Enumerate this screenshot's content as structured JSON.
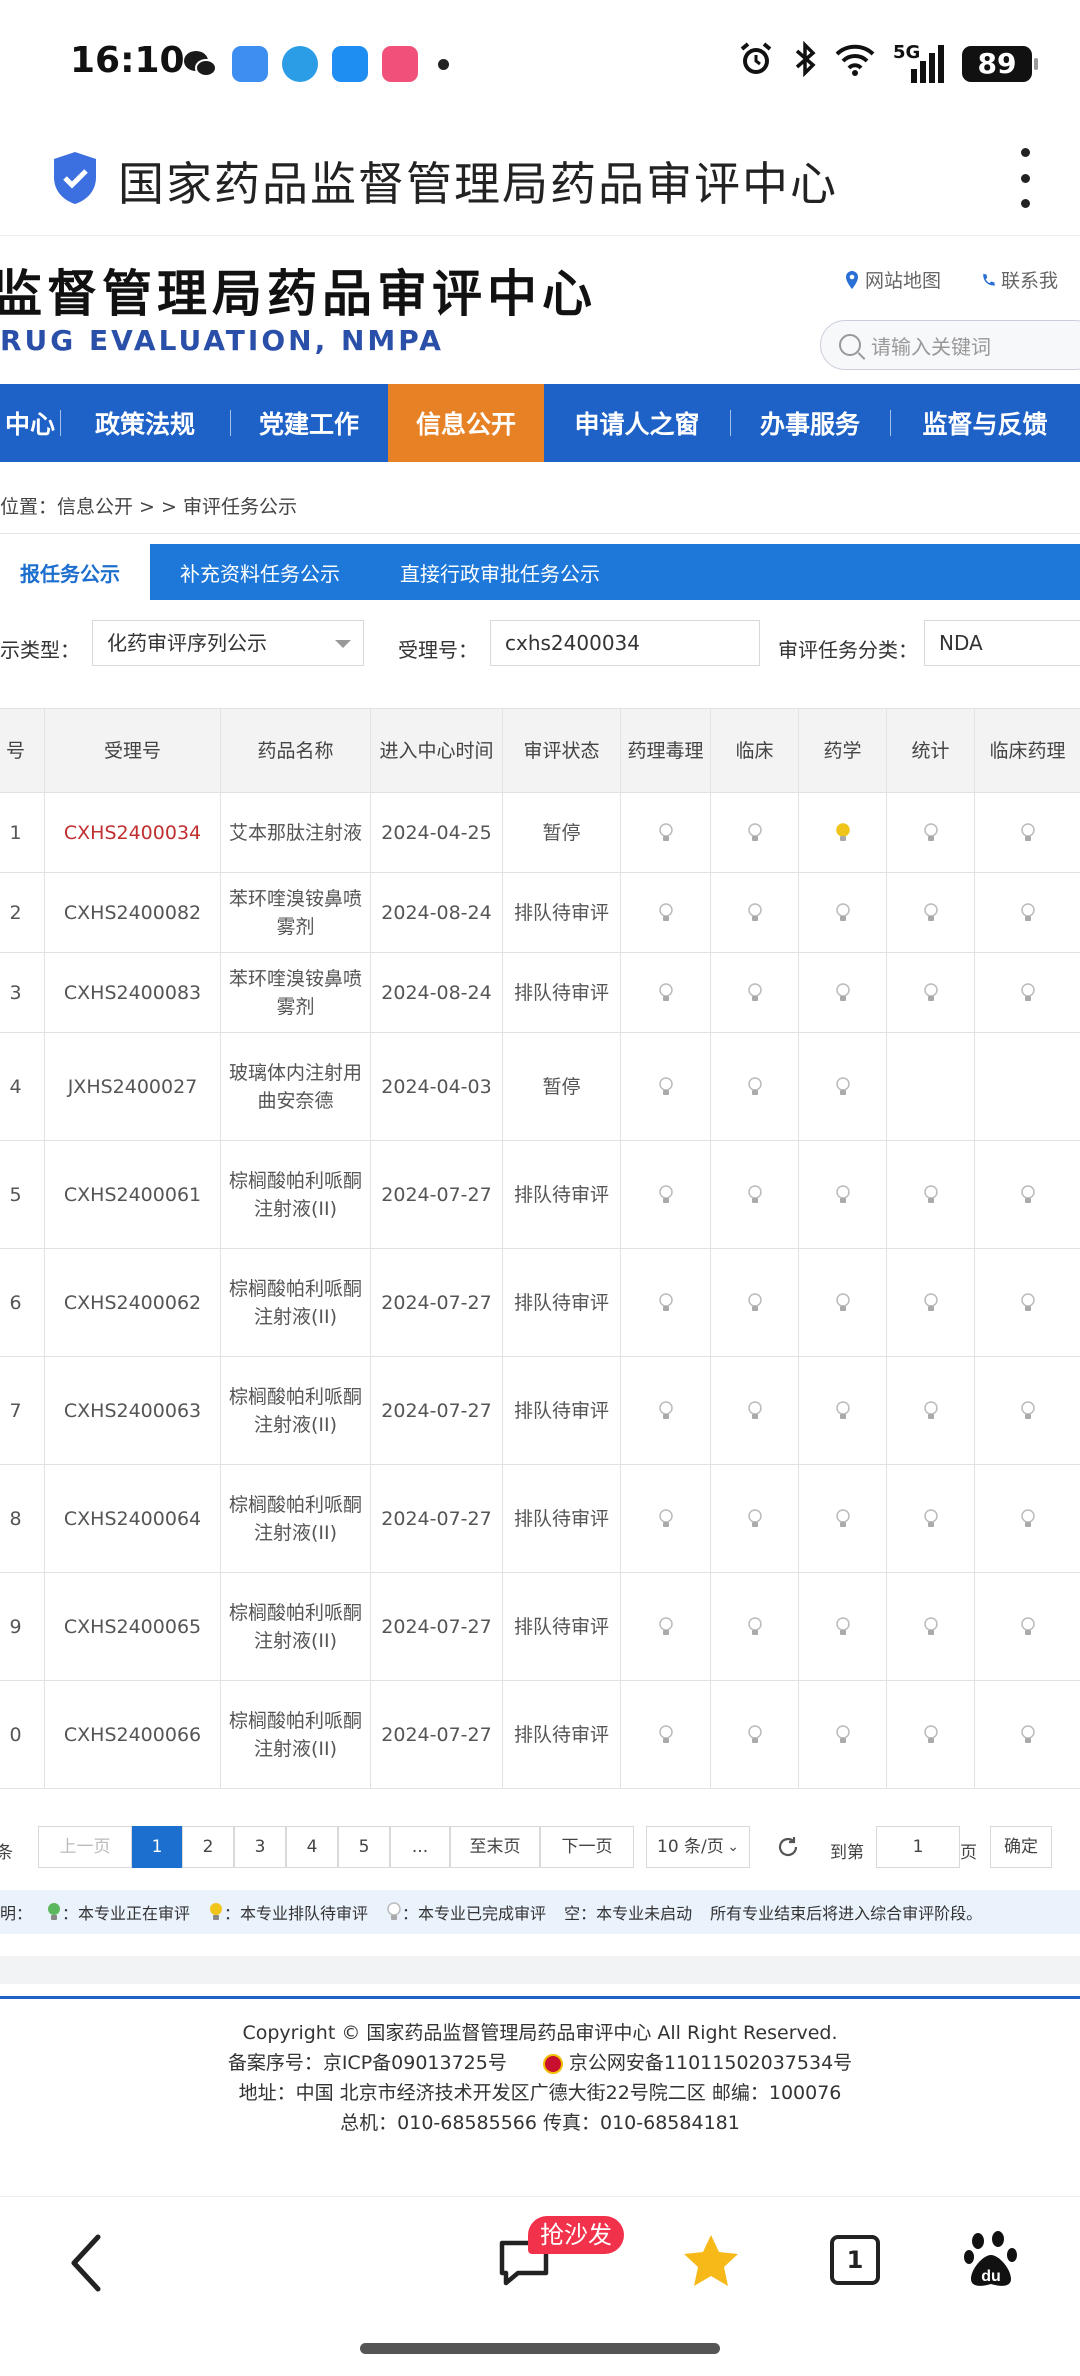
{
  "status_bar": {
    "time": "16:10",
    "network": "5G",
    "battery": "89",
    "app_icon_colors": [
      "#1a1a1a",
      "#3d8ef0",
      "#2a9de6",
      "#1f8ef2",
      "#f0507a"
    ]
  },
  "browser": {
    "title": "国家药品监督管理局药品审评中心"
  },
  "site": {
    "logo_cn": "监督管理局药品审评中心",
    "logo_en": "RUG EVALUATION, NMPA",
    "links": [
      "网站地图",
      "联系我"
    ],
    "search_placeholder": "请输入关键词"
  },
  "nav": {
    "items": [
      "中心",
      "政策法规",
      "党建工作",
      "信息公开",
      "申请人之窗",
      "办事服务",
      "监督与反馈"
    ],
    "active_index": 3,
    "active_color": "#e78125",
    "bar_color": "#1e62c7"
  },
  "breadcrumb": "位置：信息公开 > > 审评任务公示",
  "subtabs": {
    "items": [
      "报任务公示",
      "补充资料任务公示",
      "直接行政审批任务公示"
    ],
    "active_index": 0
  },
  "filters": {
    "type_label": "示类型：",
    "type_value": "化药审评序列公示",
    "accept_no_label": "受理号：",
    "accept_no_value": "cxhs2400034",
    "category_label": "审评任务分类：",
    "category_value": "NDA"
  },
  "table": {
    "headers": [
      "号",
      "受理号",
      "药品名称",
      "进入中心时间",
      "审评状态",
      "药理毒理",
      "临床",
      "药学",
      "统计",
      "临床药理"
    ],
    "rows": [
      {
        "seq": "1",
        "id": "CXHS2400034",
        "highlight": true,
        "name": "艾本那肽注射液",
        "date": "2024-04-25",
        "status": "暂停",
        "bulbs": [
          "done",
          "done",
          "queue",
          "done",
          "done"
        ]
      },
      {
        "seq": "2",
        "id": "CXHS2400082",
        "highlight": false,
        "name": "苯环喹溴铵鼻喷雾剂",
        "date": "2024-08-24",
        "status": "排队待审评",
        "bulbs": [
          "done",
          "done",
          "done",
          "done",
          "done"
        ]
      },
      {
        "seq": "3",
        "id": "CXHS2400083",
        "highlight": false,
        "name": "苯环喹溴铵鼻喷雾剂",
        "date": "2024-08-24",
        "status": "排队待审评",
        "bulbs": [
          "done",
          "done",
          "done",
          "done",
          "done"
        ]
      },
      {
        "seq": "4",
        "id": "JXHS2400027",
        "highlight": false,
        "name": "玻璃体内注射用曲安奈德",
        "date": "2024-04-03",
        "status": "暂停",
        "bulbs": [
          "done",
          "done",
          "done",
          "none",
          "none"
        ]
      },
      {
        "seq": "5",
        "id": "CXHS2400061",
        "highlight": false,
        "name": "棕榈酸帕利哌酮注射液(II)",
        "date": "2024-07-27",
        "status": "排队待审评",
        "bulbs": [
          "done",
          "done",
          "done",
          "done",
          "done"
        ]
      },
      {
        "seq": "6",
        "id": "CXHS2400062",
        "highlight": false,
        "name": "棕榈酸帕利哌酮注射液(II)",
        "date": "2024-07-27",
        "status": "排队待审评",
        "bulbs": [
          "done",
          "done",
          "done",
          "done",
          "done"
        ]
      },
      {
        "seq": "7",
        "id": "CXHS2400063",
        "highlight": false,
        "name": "棕榈酸帕利哌酮注射液(II)",
        "date": "2024-07-27",
        "status": "排队待审评",
        "bulbs": [
          "done",
          "done",
          "done",
          "done",
          "done"
        ]
      },
      {
        "seq": "8",
        "id": "CXHS2400064",
        "highlight": false,
        "name": "棕榈酸帕利哌酮注射液(II)",
        "date": "2024-07-27",
        "status": "排队待审评",
        "bulbs": [
          "done",
          "done",
          "done",
          "done",
          "done"
        ]
      },
      {
        "seq": "9",
        "id": "CXHS2400065",
        "highlight": false,
        "name": "棕榈酸帕利哌酮注射液(II)",
        "date": "2024-07-27",
        "status": "排队待审评",
        "bulbs": [
          "done",
          "done",
          "done",
          "done",
          "done"
        ]
      },
      {
        "seq": "0",
        "id": "CXHS2400066",
        "highlight": false,
        "name": "棕榈酸帕利哌酮注射液(II)",
        "date": "2024-07-27",
        "status": "排队待审评",
        "bulbs": [
          "done",
          "done",
          "done",
          "done",
          "done"
        ]
      }
    ]
  },
  "pagination": {
    "total_prefix": "条",
    "prev": "上一页",
    "pages": [
      "1",
      "2",
      "3",
      "4",
      "5",
      "..."
    ],
    "current": "1",
    "last": "至末页",
    "next": "下一页",
    "page_size": "10 条/页",
    "goto_label": "到第",
    "goto_value": "1",
    "page_unit": "页",
    "confirm": "确定"
  },
  "legend": {
    "prefix": "明：",
    "in_review": "：本专业正在审评",
    "queued": "：本专业排队待审评",
    "done": "：本专业已完成审评",
    "empty": "空：本专业未启动",
    "note": "所有专业结束后将进入综合审评阶段。",
    "colors": {
      "in_review": "#5cb85c",
      "queued": "#f0c419",
      "done": "#d0d0d0"
    }
  },
  "footer": {
    "copyright": "Copyright © 国家药品监督管理局药品审评中心   All Right Reserved.",
    "icp": "备案序号：京ICP备09013725号",
    "police": "京公网安备11011502037534号",
    "address": "地址：中国 北京市经济技术开发区广德大街22号院二区      邮编：100076",
    "phone": "总机：010-68585566      传真：010-68584181"
  },
  "bottom_bar": {
    "sofa_badge": "抢沙发",
    "tab_count": "1",
    "icons": [
      "back-icon",
      "comment-icon",
      "star-icon",
      "tabs-icon",
      "baidu-icon"
    ]
  }
}
